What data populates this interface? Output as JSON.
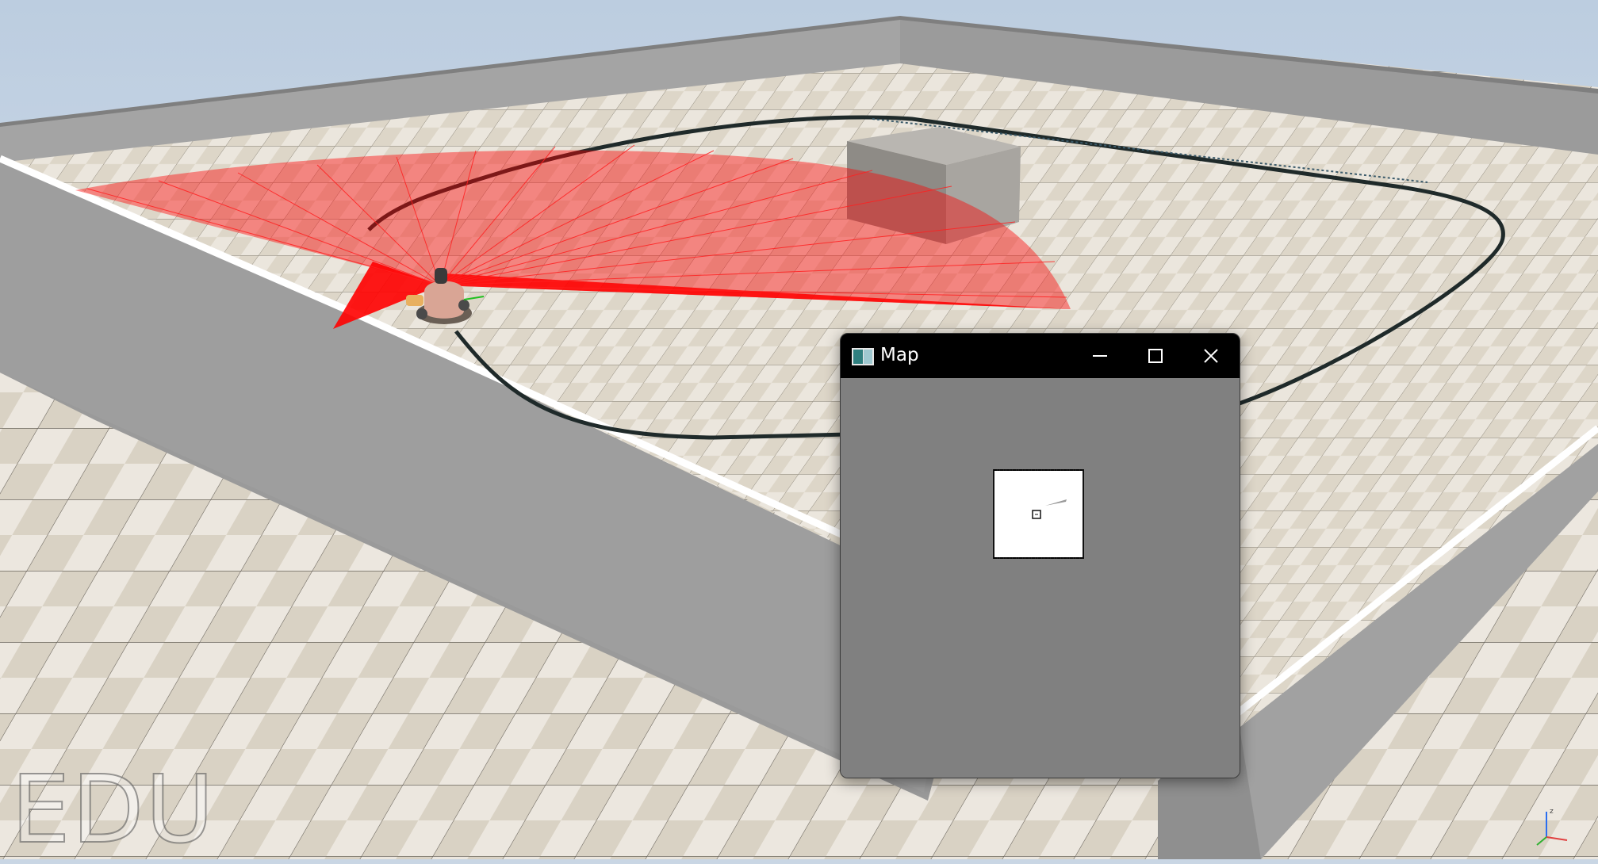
{
  "simulator": {
    "watermark": "EDU",
    "viewport": "3d-scene"
  },
  "map_window": {
    "title": "Map",
    "icon": "map-app-icon",
    "controls": {
      "minimize": "minimize-icon",
      "maximize": "maximize-icon",
      "close": "close-icon"
    },
    "background": "#808080",
    "map_canvas": "occupancy-grid"
  },
  "colors": {
    "laser": "#ff0000",
    "titlebar": "#000000",
    "map_bg": "#808080",
    "map_free": "#ffffff"
  }
}
